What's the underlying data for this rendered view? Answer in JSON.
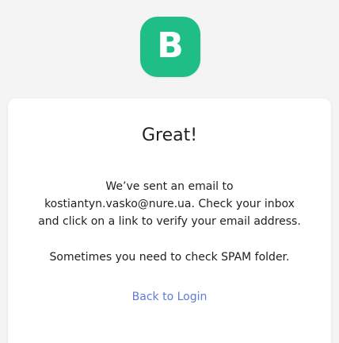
{
  "logo": {
    "letter": "B",
    "color": "#1fbe86"
  },
  "card": {
    "title": "Great!",
    "message_lines": [
      "We’ve sent an email to",
      "kostiantyn.vasko@nure.ua. Check your inbox",
      "and click on a link to verify your email address."
    ],
    "spam_note": "Sometimes you need to check SPAM folder.",
    "back_link": "Back to Login",
    "link_color": "#5e7bd6"
  }
}
